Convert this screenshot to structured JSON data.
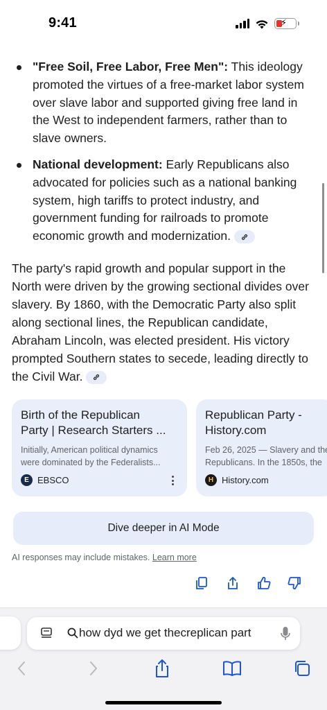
{
  "status_bar": {
    "time": "9:41"
  },
  "bullets": [
    {
      "bold": "\"Free Soil, Free Labor, Free Men\":",
      "lines": [
        "promoted the virtues of a free-market labor system",
        "over slave labor and supported giving free land in",
        "the West to independent farmers, rather than to",
        "slave owners."
      ],
      "first_line_rest": " This ideology"
    },
    {
      "bold": "National development:",
      "first_line_rest": " Early Republicans also",
      "lines": [
        "advocated for policies such as a national banking",
        "system, high tariffs to protect industry, and",
        "government funding for railroads to promote",
        "economic growth and modernization."
      ]
    }
  ],
  "paragraph": {
    "lines": [
      "The party's rapid growth and popular support in the",
      "North were driven by the growing sectional divides over",
      "slavery. By 1860, with the Democratic Party also split",
      "along sectional lines, the Republican candidate,",
      "Abraham Lincoln, was elected president. His victory",
      "prompted Southern states to secede, leading directly to",
      "the Civil War."
    ]
  },
  "cards": [
    {
      "title_line1": "Birth of the Republican",
      "title_line2": "Party | Research Starters ...",
      "snippet_line1": "Initially, American political dynamics",
      "snippet_line2": "were dominated by the Federalists...",
      "source": "EBSCO",
      "favicon_letter": "E",
      "favicon_color": "#1b2a4a"
    },
    {
      "title_line1": "Republican Party -",
      "title_line2": "History.com",
      "snippet_line1": "Feb 26, 2025 — Slavery and the",
      "snippet_line2": "Republicans. In the 1850s, the",
      "source": "History.com",
      "favicon_letter": "H",
      "favicon_color": "#1a1a1a"
    }
  ],
  "dive_button": "Dive deeper in AI Mode",
  "disclaimer": {
    "text": "AI responses may include mistakes.",
    "link": "Learn more"
  },
  "feedback_icons": [
    "copy-icon",
    "share-icon",
    "thumbs-up-icon",
    "thumbs-down-icon"
  ],
  "address_bar": {
    "query": "how dyd we get thecreplican part"
  },
  "nav_icons": [
    "back-icon",
    "forward-icon",
    "share-icon",
    "bookmarks-icon",
    "tabs-icon"
  ],
  "colors": {
    "accent_blue": "#1a56d6",
    "chip_bg": "#e6ecfa",
    "card_bg": "#e9eefb"
  }
}
